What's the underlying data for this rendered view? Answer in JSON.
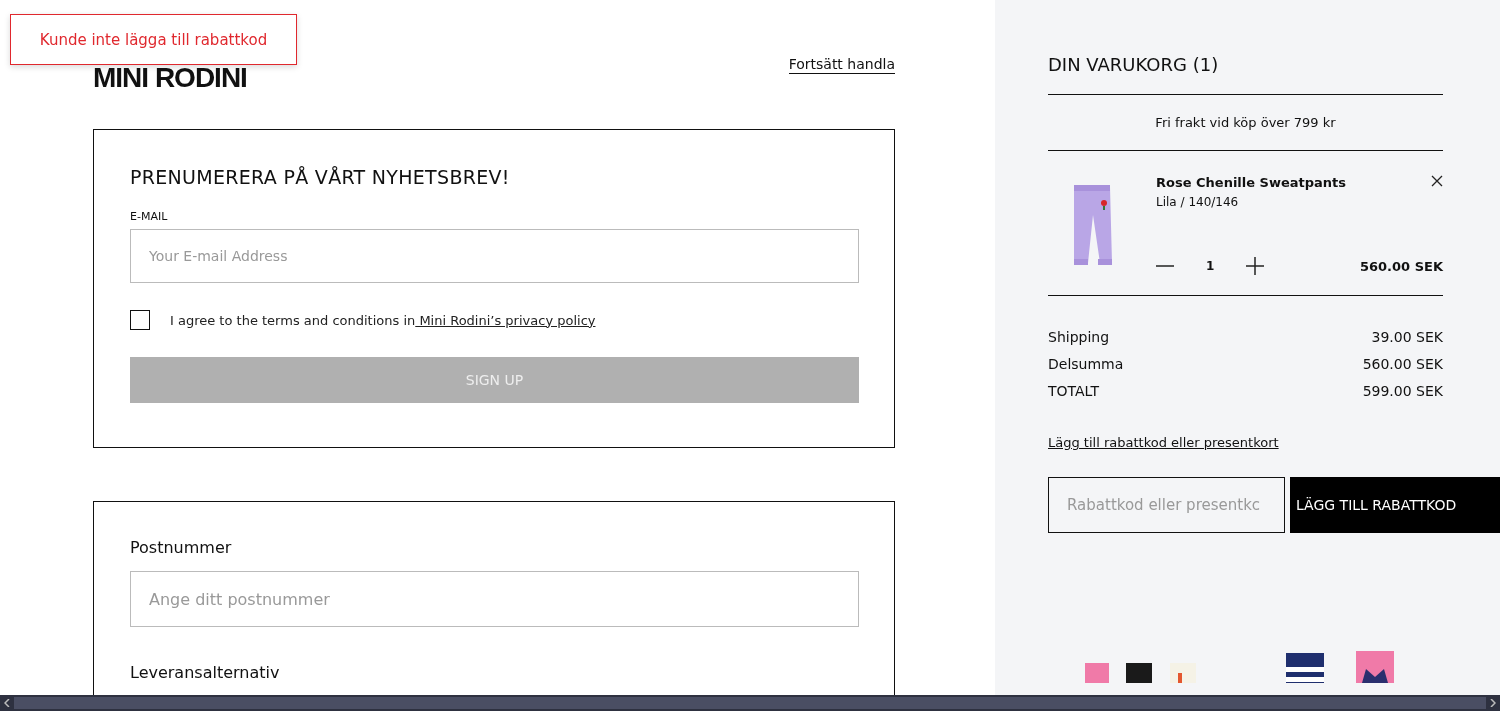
{
  "toast": {
    "message": "Kunde inte lägga till rabattkod"
  },
  "header": {
    "logo": "MINI RODINI",
    "continue_link": "Fortsätt handla"
  },
  "newsletter": {
    "title": "PRENUMERERA PÅ VÅRT NYHETSBREV!",
    "email_label": "E-MAIL",
    "email_placeholder": "Your E-mail Address",
    "consent_text": "I agree to the terms and conditions in",
    "consent_link": " Mini Rodini’s privacy policy",
    "consent_checked": false,
    "button": "SIGN UP",
    "button_disabled": true
  },
  "delivery": {
    "postcode_label": "Postnummer",
    "postcode_placeholder": "Ange ditt postnummer",
    "options_label": "Leveransalternativ"
  },
  "cart": {
    "title": "DIN VARUKORG (1)",
    "shipping_note": "Fri frakt vid köp över 799 kr",
    "items": [
      {
        "name": "Rose Chenille Sweatpants",
        "variant": "Lila / 140/146",
        "quantity": "1",
        "price": "560.00 SEK"
      }
    ],
    "totals": [
      {
        "label": "Shipping",
        "value": "39.00 SEK"
      },
      {
        "label": "Delsumma",
        "value": "560.00 SEK"
      },
      {
        "label": "TOTALT",
        "value": "599.00 SEK"
      }
    ],
    "discount_link": "Lägg till rabattkod eller presentkort",
    "discount_placeholder": "Rabattkod eller presentkc",
    "discount_button": "LÄGG TILL RABATTKOD"
  }
}
